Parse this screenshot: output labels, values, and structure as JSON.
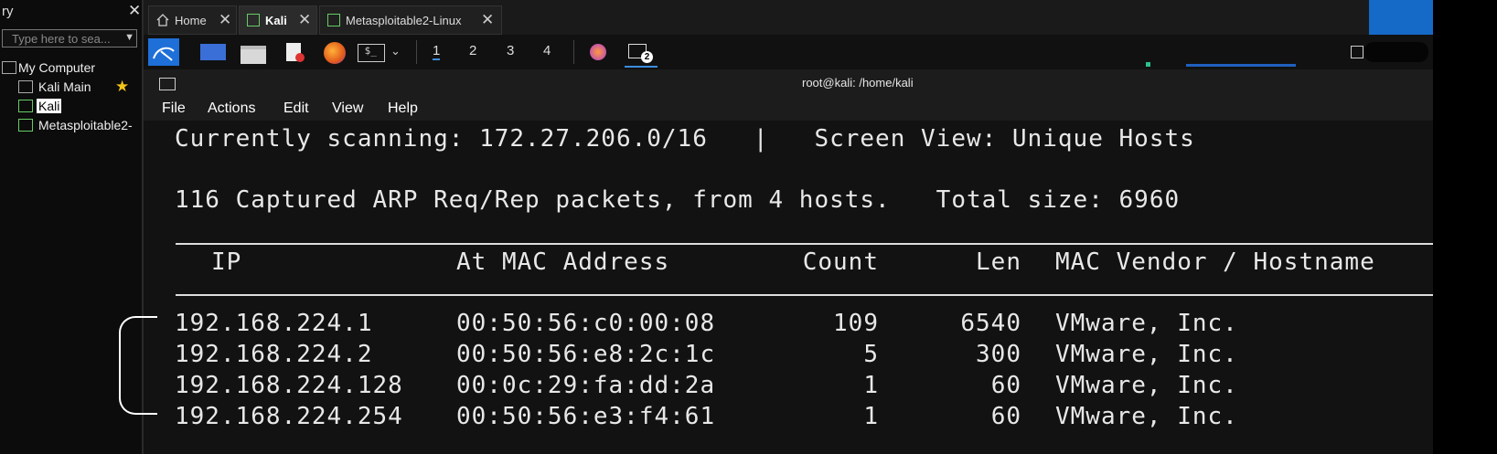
{
  "library": {
    "title": "ry",
    "search_placeholder": "Type here to sea...",
    "tree": [
      {
        "label": "My Computer"
      },
      {
        "label": "Kali Main"
      },
      {
        "label": "Kali"
      },
      {
        "label": "Metasploitable2-"
      }
    ]
  },
  "tabs": [
    {
      "label": "Home"
    },
    {
      "label": "Kali"
    },
    {
      "label": "Metasploitable2-Linux"
    }
  ],
  "taskbar": {
    "workspaces": [
      "1",
      "2",
      "3",
      "4"
    ],
    "term_badge": "2"
  },
  "terminal": {
    "title": "root@kali: /home/kali",
    "menu": [
      "File",
      "Actions",
      "Edit",
      "View",
      "Help"
    ],
    "scanning_line": "Currently scanning: 172.27.206.0/16   |   Screen View: Unique Hosts",
    "summary_line": "116 Captured ARP Req/Rep packets, from 4 hosts.   Total size: 6960",
    "columns": [
      "IP",
      "At MAC Address",
      "Count",
      "Len",
      "MAC Vendor / Hostname"
    ],
    "rows": [
      {
        "ip": "192.168.224.1",
        "mac": "00:50:56:c0:00:08",
        "count": "109",
        "len": "6540",
        "vendor": "VMware, Inc."
      },
      {
        "ip": "192.168.224.2",
        "mac": "00:50:56:e8:2c:1c",
        "count": "5",
        "len": "300",
        "vendor": "VMware, Inc."
      },
      {
        "ip": "192.168.224.128",
        "mac": "00:0c:29:fa:dd:2a",
        "count": "1",
        "len": "60",
        "vendor": "VMware, Inc."
      },
      {
        "ip": "192.168.224.254",
        "mac": "00:50:56:e3:f4:61",
        "count": "1",
        "len": "60",
        "vendor": "VMware, Inc."
      }
    ]
  }
}
